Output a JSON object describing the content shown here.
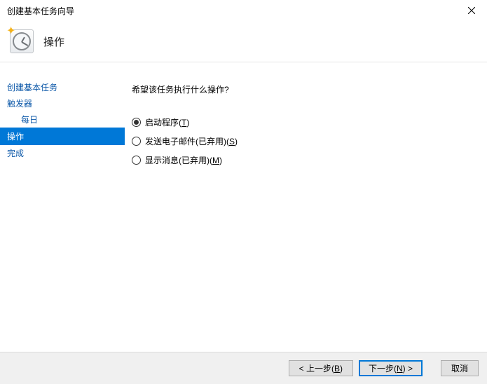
{
  "titlebar": {
    "title": "创建基本任务向导"
  },
  "header": {
    "title": "操作"
  },
  "sidebar": {
    "items": [
      {
        "label": "创建基本任务"
      },
      {
        "label": "触发器"
      },
      {
        "label": "每日"
      },
      {
        "label": "操作"
      },
      {
        "label": "完成"
      }
    ]
  },
  "main": {
    "question": "希望该任务执行什么操作?",
    "options": {
      "start_program": {
        "label": "启动程序",
        "accel": "T",
        "checked": true
      },
      "send_email": {
        "label": "发送电子邮件(已弃用)",
        "accel": "S",
        "checked": false
      },
      "show_message": {
        "label": "显示消息(已弃用)",
        "accel": "M",
        "checked": false
      }
    }
  },
  "footer": {
    "back": {
      "prefix": "< 上一步(",
      "accel": "B",
      "suffix": ")"
    },
    "next": {
      "prefix": "下一步(",
      "accel": "N",
      "suffix": ") >"
    },
    "cancel": "取消"
  }
}
